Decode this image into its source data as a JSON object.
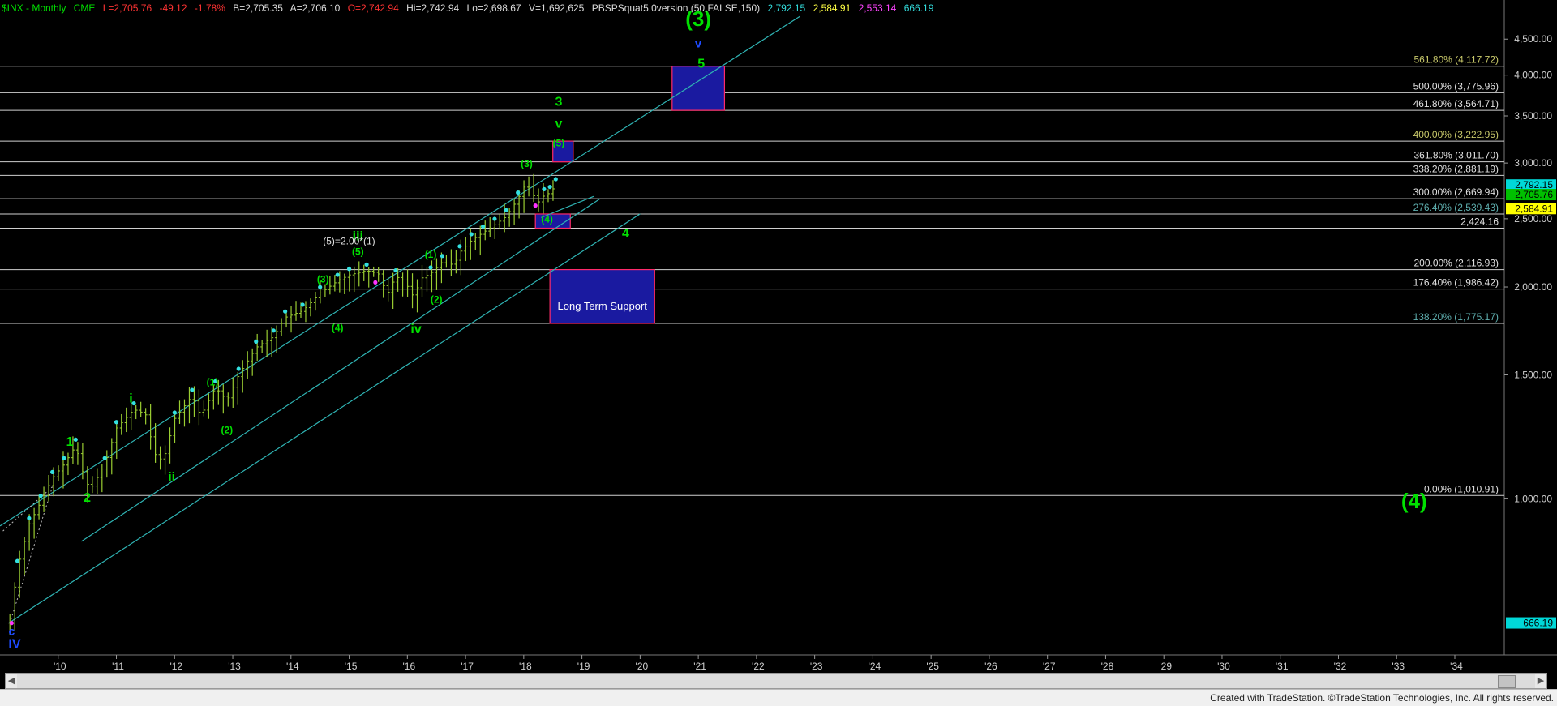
{
  "header": {
    "symbol": "$INX - Monthly",
    "exchange": "CME",
    "last": "L=2,705.76",
    "change": "-49.12",
    "change_pct": "-1.78%",
    "bid": "B=2,705.35",
    "ask": "A=2,706.10",
    "open": "O=2,742.94",
    "high": "Hi=2,742.94",
    "low": "Lo=2,698.67",
    "volume": "V=1,692,625",
    "indicator": "PBSPSquat5.0version (50,FALSE,150)",
    "ind_v1": "2,792.15",
    "ind_v2": "2,584.91",
    "ind_v3": "2,553.14",
    "ind_v4": "666.19"
  },
  "colors": {
    "background": "#000000",
    "price_bars": "#9acd32",
    "wave_label": "#00e000",
    "channel": "#2fb3b3",
    "fib_line": "#d8d8d8",
    "box_fill": "#1a1aa0",
    "box_border": "#ff2a6a",
    "last_price": "#00c000",
    "ask_price": "#ffff00"
  },
  "footer": {
    "text": "Created with TradeStation. ©TradeStation Technologies, Inc. All rights reserved."
  },
  "chart_data": {
    "type": "bar",
    "title": "$INX - Monthly",
    "y_scale": "log",
    "ylim": [
      600,
      4850
    ],
    "y_ticks": [
      1000,
      1500,
      2000,
      2500,
      3000,
      3500,
      4000,
      4500
    ],
    "y_tick_labels": [
      "1,000.00",
      "1,500.00",
      "2,000.00",
      "2,500.00",
      "3,000.00",
      "3,500.00",
      "4,000.00",
      "4,500.00"
    ],
    "x_ticks": [
      "'10",
      "'11",
      "'12",
      "'13",
      "'14",
      "'15",
      "'16",
      "'17",
      "'18",
      "'19",
      "'20",
      "'21",
      "'22",
      "'23",
      "'24",
      "'25",
      "'26",
      "'27",
      "'28",
      "'29",
      "'30",
      "'31",
      "'32",
      "'33",
      "'34"
    ],
    "xlim": [
      2009.0,
      2034.85
    ],
    "grid": false,
    "fib_levels": [
      {
        "label": "561.80% (4,117.72)",
        "value": 4117.72,
        "color": "#c8c86a"
      },
      {
        "label": "500.00% (3,775.96)",
        "value": 3775.96,
        "color": "#e0e0e0"
      },
      {
        "label": "461.80% (3,564.71)",
        "value": 3564.71,
        "color": "#e0e0e0"
      },
      {
        "label": "400.00% (3,222.95)",
        "value": 3222.95,
        "color": "#c8c86a"
      },
      {
        "label": "361.80% (3,011.70)",
        "value": 3011.7,
        "color": "#e0e0e0"
      },
      {
        "label": "338.20% (2,881.19)",
        "value": 2881.19,
        "color": "#e0e0e0"
      },
      {
        "label": "300.00% (2,669.94)",
        "value": 2669.94,
        "color": "#e0e0e0"
      },
      {
        "label": "276.40% (2,539.43)",
        "value": 2539.43,
        "color": "#5fb0b0"
      },
      {
        "label": "2,424.16",
        "value": 2424.16,
        "color": "#e0e0e0"
      },
      {
        "label": "200.00% (2,116.93)",
        "value": 2116.93,
        "color": "#e0e0e0"
      },
      {
        "label": "176.40% (1,986.42)",
        "value": 1986.42,
        "color": "#e0e0e0"
      },
      {
        "label": "138.20% (1,775.17)",
        "value": 1775.17,
        "color": "#5fb0b0"
      },
      {
        "label": "0.00% (1,010.91)",
        "value": 1010.91,
        "color": "#e0e0e0"
      }
    ],
    "price_tags": [
      {
        "label": "2,792.15",
        "value": 2792.15,
        "bg": "#00d8d8",
        "fg": "#000"
      },
      {
        "label": "2,705.76",
        "value": 2705.76,
        "bg": "#00c000",
        "fg": "#000"
      },
      {
        "label": "2,584.91",
        "value": 2584.91,
        "bg": "#ffff00",
        "fg": "#000"
      },
      {
        "label": "666.19",
        "value": 666.19,
        "bg": "#00d8d8",
        "fg": "#000"
      }
    ],
    "boxes": [
      {
        "name": "target-box-3",
        "x0": 2020.55,
        "x1": 2021.45,
        "y0": 3564.71,
        "y1": 4117.72,
        "label": ""
      },
      {
        "name": "target-box-5",
        "x0": 2018.5,
        "x1": 2018.85,
        "y0": 3011.7,
        "y1": 3222.95,
        "label": ""
      },
      {
        "name": "support-box-4",
        "x0": 2018.2,
        "x1": 2018.8,
        "y0": 2424.16,
        "y1": 2539.43,
        "label": ""
      },
      {
        "name": "long-term-support",
        "x0": 2018.45,
        "x1": 2020.25,
        "y0": 1775.17,
        "y1": 2116.93,
        "label": "Long Term Support"
      }
    ],
    "channels": [
      {
        "x0": 2009.0,
        "y0": 915,
        "x1": 2022.75,
        "y1": 4850
      },
      {
        "x0": 2009.15,
        "y0": 666,
        "x1": 2020.0,
        "y1": 2540
      },
      {
        "x0": 2010.4,
        "y0": 870,
        "x1": 2019.3,
        "y1": 2665
      },
      {
        "x0": 2018.3,
        "y0": 2510,
        "x1": 2019.2,
        "y1": 2690
      }
    ],
    "wave_labels": [
      {
        "text": "(3)",
        "x": 2021.0,
        "y": 4700,
        "color": "#00e000",
        "size": 26
      },
      {
        "text": "v",
        "x": 2021.0,
        "y": 4380,
        "color": "#1e4bff",
        "size": 16
      },
      {
        "text": "5",
        "x": 2021.05,
        "y": 4100,
        "color": "#00e000",
        "size": 16
      },
      {
        "text": "3",
        "x": 2018.6,
        "y": 3620,
        "color": "#00e000",
        "size": 16
      },
      {
        "text": "v",
        "x": 2018.6,
        "y": 3370,
        "color": "#00e000",
        "size": 16
      },
      {
        "text": "(5)",
        "x": 2018.6,
        "y": 3170,
        "color": "#00e000",
        "size": 12
      },
      {
        "text": "(3)",
        "x": 2018.05,
        "y": 2960,
        "color": "#00e000",
        "size": 12
      },
      {
        "text": "(4)",
        "x": 2018.4,
        "y": 2470,
        "color": "#00e000",
        "size": 12
      },
      {
        "text": "4",
        "x": 2019.75,
        "y": 2350,
        "color": "#00e000",
        "size": 16
      },
      {
        "text": "iii",
        "x": 2015.15,
        "y": 2330,
        "color": "#00e000",
        "size": 16
      },
      {
        "text": "(5)",
        "x": 2015.15,
        "y": 2220,
        "color": "#00e000",
        "size": 12
      },
      {
        "text": "(3)",
        "x": 2014.55,
        "y": 2030,
        "color": "#00e000",
        "size": 12
      },
      {
        "text": "(4)",
        "x": 2014.8,
        "y": 1730,
        "color": "#00e000",
        "size": 12
      },
      {
        "text": "(1)",
        "x": 2016.4,
        "y": 2200,
        "color": "#00e000",
        "size": 12
      },
      {
        "text": "(2)",
        "x": 2016.5,
        "y": 1900,
        "color": "#00e000",
        "size": 12
      },
      {
        "text": "iv",
        "x": 2016.15,
        "y": 1720,
        "color": "#00e000",
        "size": 16
      },
      {
        "text": "(1)",
        "x": 2012.65,
        "y": 1450,
        "color": "#00e000",
        "size": 12
      },
      {
        "text": "(2)",
        "x": 2012.9,
        "y": 1240,
        "color": "#00e000",
        "size": 12
      },
      {
        "text": "i",
        "x": 2011.25,
        "y": 1370,
        "color": "#00e000",
        "size": 16
      },
      {
        "text": "ii",
        "x": 2011.95,
        "y": 1060,
        "color": "#00e000",
        "size": 16
      },
      {
        "text": "1",
        "x": 2010.2,
        "y": 1190,
        "color": "#00e000",
        "size": 16
      },
      {
        "text": "2",
        "x": 2010.5,
        "y": 990,
        "color": "#00e000",
        "size": 16
      },
      {
        "text": "(4)",
        "x": 2033.3,
        "y": 970,
        "color": "#00e000",
        "size": 26
      },
      {
        "text": "c",
        "x": 2009.2,
        "y": 640,
        "color": "#1e4bff",
        "size": 14
      },
      {
        "text": "IV",
        "x": 2009.25,
        "y": 614,
        "color": "#1e4bff",
        "size": 16
      }
    ],
    "annotation": {
      "text": "(5)=2.00*(1)",
      "x": 2014.55,
      "y": 2300,
      "color": "#e0e0e0"
    },
    "price_path": [
      [
        2009.17,
        666
      ],
      [
        2009.3,
        800
      ],
      [
        2009.5,
        920
      ],
      [
        2009.7,
        990
      ],
      [
        2009.9,
        1070
      ],
      [
        2010.1,
        1120
      ],
      [
        2010.3,
        1190
      ],
      [
        2010.45,
        1070
      ],
      [
        2010.55,
        1030
      ],
      [
        2010.8,
        1120
      ],
      [
        2011.0,
        1260
      ],
      [
        2011.3,
        1340
      ],
      [
        2011.5,
        1320
      ],
      [
        2011.65,
        1160
      ],
      [
        2011.8,
        1130
      ],
      [
        2012.0,
        1300
      ],
      [
        2012.3,
        1400
      ],
      [
        2012.45,
        1310
      ],
      [
        2012.7,
        1440
      ],
      [
        2012.9,
        1380
      ],
      [
        2013.1,
        1500
      ],
      [
        2013.4,
        1640
      ],
      [
        2013.7,
        1700
      ],
      [
        2013.9,
        1810
      ],
      [
        2014.2,
        1850
      ],
      [
        2014.5,
        1960
      ],
      [
        2014.8,
        2040
      ],
      [
        2015.0,
        2080
      ],
      [
        2015.3,
        2110
      ],
      [
        2015.5,
        2090
      ],
      [
        2015.65,
        1950
      ],
      [
        2015.8,
        2070
      ],
      [
        2015.95,
        2040
      ],
      [
        2016.1,
        1940
      ],
      [
        2016.25,
        2060
      ],
      [
        2016.4,
        2090
      ],
      [
        2016.6,
        2170
      ],
      [
        2016.8,
        2150
      ],
      [
        2016.9,
        2240
      ],
      [
        2017.1,
        2330
      ],
      [
        2017.3,
        2390
      ],
      [
        2017.5,
        2450
      ],
      [
        2017.7,
        2520
      ],
      [
        2017.9,
        2670
      ],
      [
        2018.05,
        2820
      ],
      [
        2018.15,
        2710
      ],
      [
        2018.25,
        2640
      ],
      [
        2018.35,
        2700
      ],
      [
        2018.45,
        2720
      ],
      [
        2018.55,
        2790
      ],
      [
        2018.58,
        2705
      ]
    ],
    "swing_markers": [
      {
        "x": 2018.2,
        "y": 2610,
        "color": "#ff33ff"
      },
      {
        "x": 2015.45,
        "y": 2030,
        "color": "#ff33ff"
      },
      {
        "x": 2009.2,
        "y": 666,
        "color": "#ff33ff"
      }
    ]
  }
}
